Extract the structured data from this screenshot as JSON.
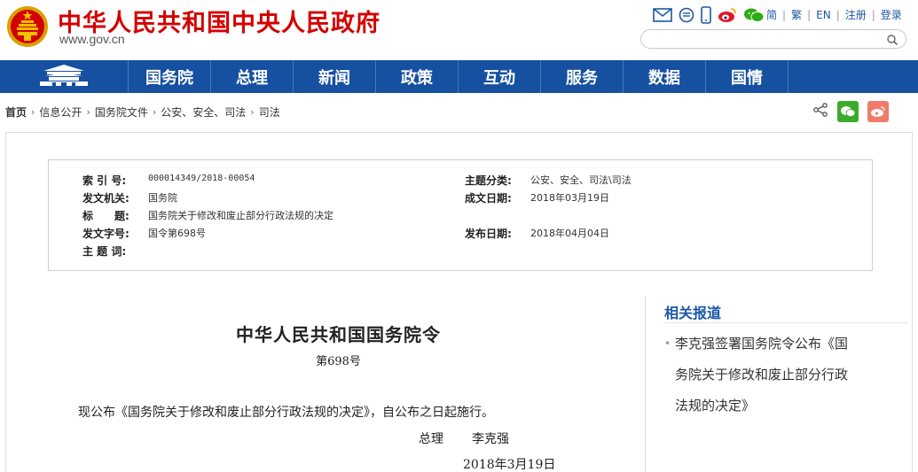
{
  "header": {
    "site_title": "中华人民共和国中央人民政府",
    "site_url": "www.gov.cn",
    "icons": [
      "mail-icon",
      "app-icon",
      "mobile-icon",
      "weibo-icon",
      "wechat-icon"
    ],
    "lang_links": [
      "简",
      "繁",
      "EN",
      "注册",
      "登录"
    ],
    "search": {
      "value": "",
      "placeholder": ""
    }
  },
  "nav": {
    "home_icon": "tiananmen-icon",
    "items": [
      "国务院",
      "总理",
      "新闻",
      "政策",
      "互动",
      "服务",
      "数据",
      "国情"
    ]
  },
  "breadcrumb": [
    "首页",
    "信息公开",
    "国务院文件",
    "公安、安全、司法",
    "司法"
  ],
  "share_icons": [
    "share-icon",
    "wechat-share-icon",
    "weibo-share-icon"
  ],
  "meta": {
    "index_label": "索 引 号:",
    "index_value": "000014349/2018-00054",
    "category_label": "主题分类:",
    "category_value": "公安、安全、司法\\司法",
    "issuer_label": "发文机关:",
    "issuer_value": "国务院",
    "date_written_label": "成文日期:",
    "date_written_value": "2018年03月19日",
    "title_label": "标　　题:",
    "title_value": "国务院关于修改和废止部分行政法规的决定",
    "doc_no_label": "发文字号:",
    "doc_no_value": "国令第698号",
    "publish_label": "发布日期:",
    "publish_value": "2018年04月04日",
    "keywords_label": "主 题 词:",
    "keywords_value": ""
  },
  "article": {
    "title": "中华人民共和国国务院令",
    "number": "第698号",
    "body": "现公布《国务院关于修改和废止部分行政法规的决定》，自公布之日起施行。",
    "sign_role": "总理",
    "sign_name": "李克强",
    "date": "2018年3月19日"
  },
  "sidebar": {
    "title": "相关报道",
    "items": [
      "李克强签署国务院令公布《国务院关于修改和废止部分行政法规的决定》"
    ],
    "items_display": [
      "李克强签署国务院令公布《国",
      "务院关于修改和废止部分行政",
      "法规的决定》"
    ]
  },
  "colors": {
    "brand_red": "#d40000",
    "nav_blue": "#1650a0",
    "link_blue": "#1b57a6"
  }
}
